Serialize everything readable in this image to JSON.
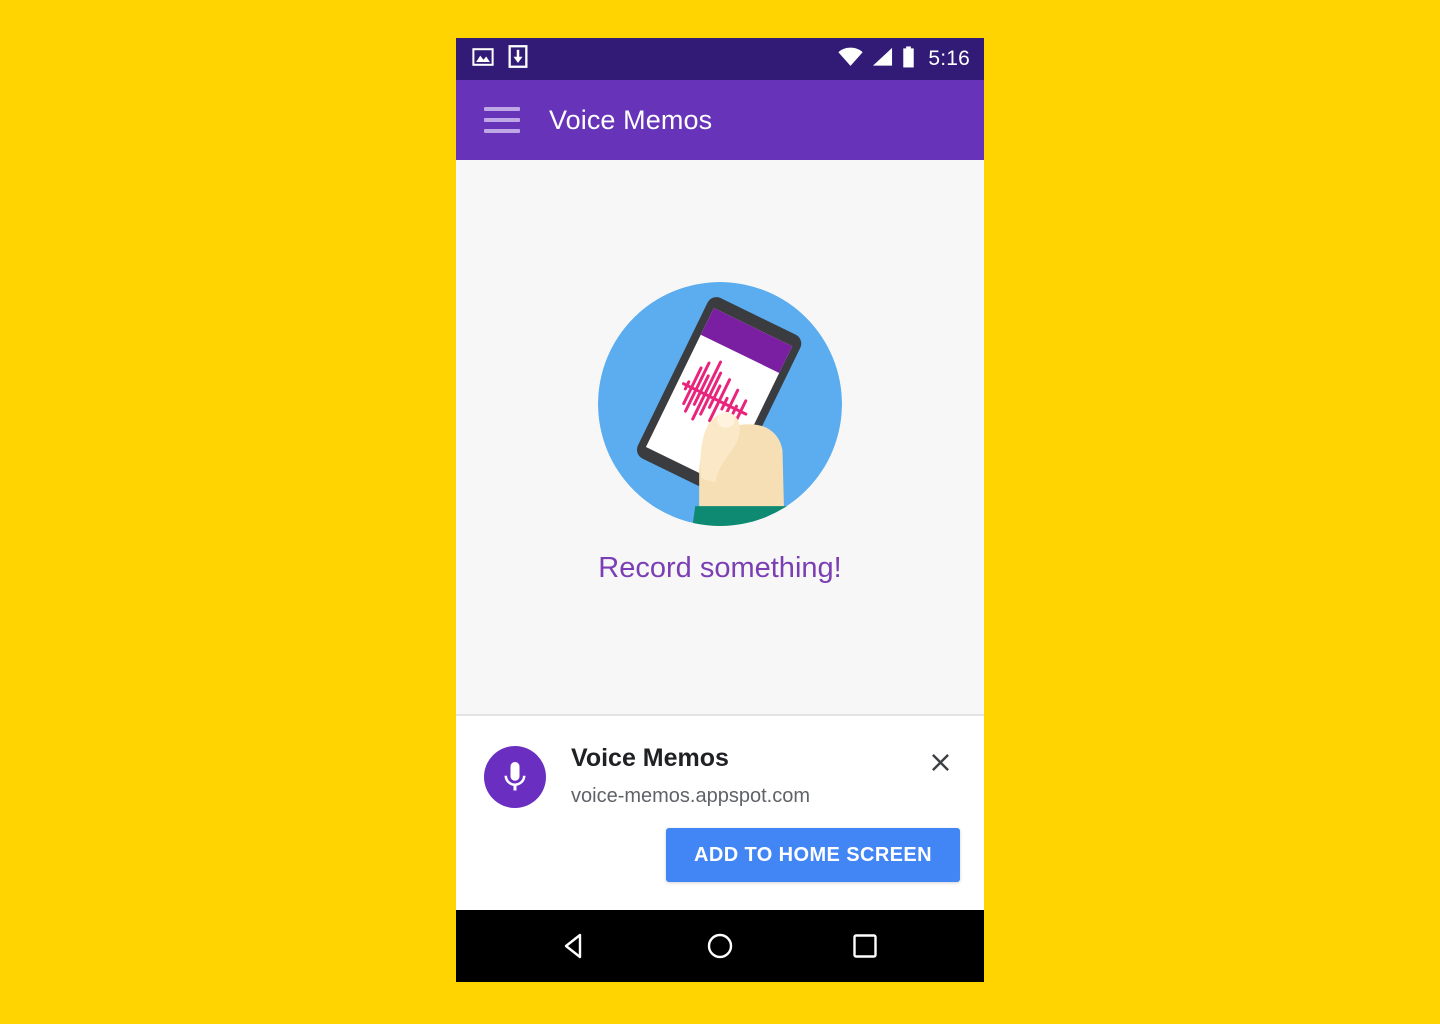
{
  "page": {
    "background_color": "#FFD400"
  },
  "device": {
    "status_bar": {
      "background_color": "#311B77",
      "time": "5:16",
      "notification_icons": [
        "image-icon",
        "download-icon"
      ],
      "system_icons": [
        "wifi-icon",
        "cellular-signal-icon",
        "battery-icon"
      ]
    },
    "nav_bar": {
      "background_color": "#000000",
      "buttons": [
        {
          "name": "back",
          "icon": "triangle-left-icon"
        },
        {
          "name": "home",
          "icon": "circle-icon"
        },
        {
          "name": "recents",
          "icon": "square-icon"
        }
      ]
    }
  },
  "toolbar": {
    "background_color": "#6733B9",
    "menu_icon": "hamburger-menu-icon",
    "title": "Voice Memos"
  },
  "main": {
    "background_color": "#F7F7F7",
    "empty_state": {
      "illustration": "hand-holding-phone-recording-illustration",
      "circle_color": "#5BADF0",
      "waveform_color": "#E8247D",
      "phone_bar_color": "#7B1FA2",
      "sleeve_color": "#0E8A72",
      "skin_color": "#F6DEB5",
      "message": "Record something!",
      "message_color": "#7B3FB5"
    }
  },
  "install_banner": {
    "background_color": "#FFFFFF",
    "app_icon": "microphone-icon",
    "app_icon_background": "#6A2FC0",
    "app_name": "Voice Memos",
    "app_url": "voice-memos.appspot.com",
    "close_icon": "close-icon",
    "install_button_label": "ADD TO HOME SCREEN",
    "install_button_color": "#4285F4"
  }
}
